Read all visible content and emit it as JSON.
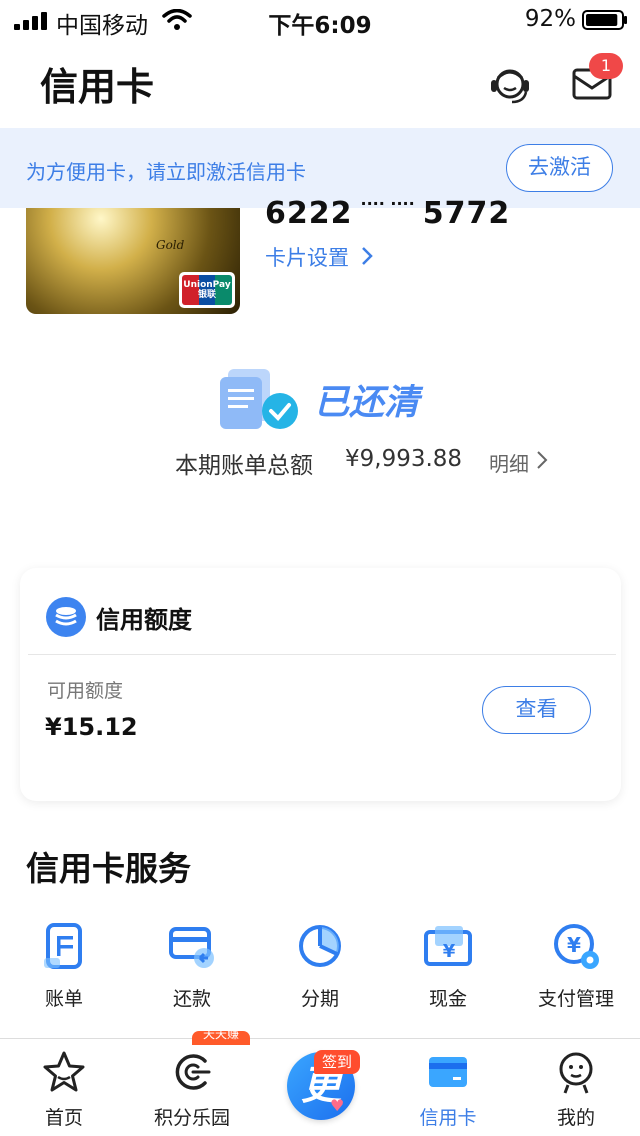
{
  "status_bar": {
    "carrier": "中国移动",
    "time": "下午6:09",
    "battery_pct": "92%",
    "battery_level": 0.92
  },
  "header": {
    "title": "信用卡",
    "mail_badge": "1"
  },
  "activate_banner": {
    "text": "为方便用卡，请立即激活信用卡",
    "button": "去激活"
  },
  "card": {
    "number_start": "6222",
    "number_mask": "····  ····",
    "number_end": "5772",
    "gold_label": "Gold",
    "unionpay_text": "UnionPay",
    "unionpay_cn": "银联",
    "settings_link": "卡片设置"
  },
  "bill": {
    "status": "已还清",
    "label": "本期账单总额",
    "amount": "¥9,993.88",
    "detail_link": "明细"
  },
  "credit_limit": {
    "title": "信用额度",
    "available_label": "可用额度",
    "available_value": "¥15.12",
    "view_button": "查看"
  },
  "services": {
    "title": "信用卡服务",
    "items": [
      {
        "label": "账单",
        "icon": "bill-icon"
      },
      {
        "label": "还款",
        "icon": "repay-icon"
      },
      {
        "label": "分期",
        "icon": "installment-icon"
      },
      {
        "label": "现金",
        "icon": "cash-icon"
      },
      {
        "label": "支付管理",
        "icon": "payment-settings-icon"
      }
    ]
  },
  "tabbar": {
    "items": [
      {
        "label": "首页",
        "icon": "star-icon"
      },
      {
        "label": "积分乐园",
        "icon": "points-icon"
      },
      {
        "label": "信用卡",
        "icon": "credit-card-icon",
        "active": true
      },
      {
        "label": "我的",
        "icon": "profile-icon"
      }
    ],
    "center_glyph": "更",
    "checkin_badge": "签到",
    "promo_text": "天天赚"
  },
  "colors": {
    "accent": "#3d7ee6",
    "banner_bg": "#eaf1fd",
    "badge_red": "#f04848"
  }
}
